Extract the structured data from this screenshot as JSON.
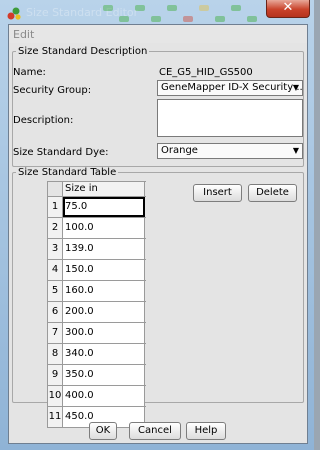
{
  "window": {
    "title": "Size Standard Editor",
    "close_glyph": "✕"
  },
  "menu": {
    "edit_label": "Edit"
  },
  "description_section": {
    "legend": "Size Standard Description",
    "name_label": "Name:",
    "name_value": "CE_G5_HID_GS500",
    "security_group_label": "Security Group:",
    "security_group_value": "GeneMapper ID-X Security ...",
    "description_label": "Description:",
    "description_value": "",
    "dye_label": "Size Standard Dye:",
    "dye_value": "Orange"
  },
  "table_section": {
    "legend": "Size Standard Table",
    "column_header": "Size in Basepairs",
    "rows": [
      {
        "n": "1",
        "v": "75.0"
      },
      {
        "n": "2",
        "v": "100.0"
      },
      {
        "n": "3",
        "v": "139.0"
      },
      {
        "n": "4",
        "v": "150.0"
      },
      {
        "n": "5",
        "v": "160.0"
      },
      {
        "n": "6",
        "v": "200.0"
      },
      {
        "n": "7",
        "v": "300.0"
      },
      {
        "n": "8",
        "v": "340.0"
      },
      {
        "n": "9",
        "v": "350.0"
      },
      {
        "n": "10",
        "v": "400.0"
      },
      {
        "n": "11",
        "v": "450.0"
      }
    ],
    "insert_label": "Insert",
    "delete_label": "Delete"
  },
  "footer": {
    "ok_label": "OK",
    "cancel_label": "Cancel",
    "help_label": "Help"
  },
  "icons": {
    "dropdown": "chevron-down-icon",
    "close": "close-icon",
    "app": "app-icon"
  }
}
